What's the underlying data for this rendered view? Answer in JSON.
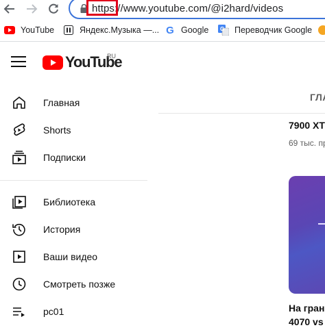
{
  "browser": {
    "url_scheme": "https:",
    "url_rest": "//www.youtube.com/@i2hard/videos",
    "bookmarks": [
      {
        "label": "YouTube",
        "icon": "youtube-icon"
      },
      {
        "label": "Яндекс.Музыка —...",
        "icon": "pause-icon"
      },
      {
        "label": "Google",
        "icon": "google-icon"
      },
      {
        "label": "Переводчик Google",
        "icon": "translate-icon"
      }
    ],
    "highlight_color": "#e0001b",
    "address_border_color": "#3b73d9"
  },
  "youtube": {
    "logo_text": "YouTube",
    "logo_region": "RU",
    "brand_color": "#ff0000",
    "sidebar": [
      {
        "label": "Главная",
        "icon": "home-icon"
      },
      {
        "label": "Shorts",
        "icon": "shorts-icon"
      },
      {
        "label": "Подписки",
        "icon": "subscriptions-icon"
      },
      {
        "label": "Библиотека",
        "icon": "library-icon"
      },
      {
        "label": "История",
        "icon": "history-icon"
      },
      {
        "label": "Ваши видео",
        "icon": "your-videos-icon"
      },
      {
        "label": "Смотреть позже",
        "icon": "watch-later-icon"
      },
      {
        "label": "pc01",
        "icon": "playlist-icon"
      }
    ]
  },
  "main": {
    "tab_label": "ГЛА",
    "video1_title": "7900 XT",
    "video1_meta": "69 тыс. пр",
    "video2_title_line1": "На грань",
    "video2_title_line2": "4070 vs"
  }
}
